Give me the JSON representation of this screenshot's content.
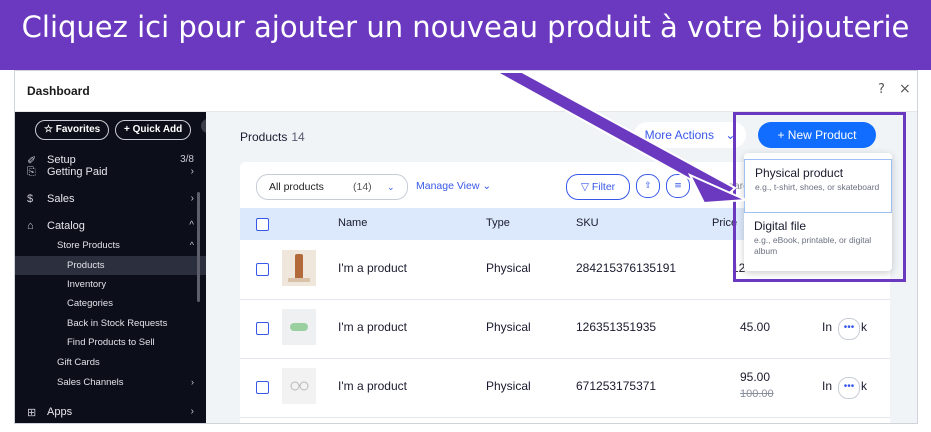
{
  "banner": {
    "text": "Cliquez ici pour ajouter un nouveau produit à votre bijouterie"
  },
  "window": {
    "title": "Dashboard",
    "help": "?",
    "close": "×"
  },
  "sidebar": {
    "favorites": "☆ Favorites",
    "quick_add": "+ Quick Add",
    "collapse": "‹",
    "items": [
      {
        "icon": "✐",
        "label": "Setup",
        "right": "3/8"
      },
      {
        "icon": "⎘",
        "label": "Getting Paid",
        "right": "›"
      },
      {
        "icon": "$",
        "label": "Sales",
        "right": "›"
      },
      {
        "icon": "⌂",
        "label": "Catalog",
        "right": "^"
      }
    ],
    "subitems": [
      {
        "label": "Store Products",
        "right": "^"
      },
      {
        "label": "Products",
        "right": ""
      },
      {
        "label": "Inventory",
        "right": ""
      },
      {
        "label": "Categories",
        "right": ""
      },
      {
        "label": "Back in Stock Requests",
        "right": ""
      },
      {
        "label": "Find Products to Sell",
        "right": ""
      },
      {
        "label": "Gift Cards",
        "right": ""
      },
      {
        "label": "Sales Channels",
        "right": "›"
      }
    ],
    "apps": {
      "icon": "⊞",
      "label": "Apps",
      "right": "›"
    }
  },
  "main": {
    "title": "Products",
    "count": "14",
    "more_actions": "More Actions",
    "more_actions_chev": "⌄",
    "new_product": "+ New Product",
    "toolbar": {
      "select_label": "All products",
      "select_count": "(14)",
      "select_chev": "⌄",
      "manage_view": "Manage View ⌄",
      "filter": "▽ Filter",
      "export_icon": "⇧",
      "columns_icon": "≡",
      "search_placeholder": "earch..."
    },
    "columns": {
      "name": "Name",
      "type": "Type",
      "sku": "SKU",
      "price": "Price"
    },
    "rows": [
      {
        "name": "I'm a product",
        "type": "Physical",
        "sku": "284215376135191",
        "price": "12",
        "old_price": "",
        "inventory": ""
      },
      {
        "name": "I'm a product",
        "type": "Physical",
        "sku": "126351351935",
        "price": "45.00",
        "old_price": "",
        "inventory": "In",
        "inventory_tail": "k"
      },
      {
        "name": "I'm a product",
        "type": "Physical",
        "sku": "671253175371",
        "price": "95.00",
        "old_price": "100.00",
        "inventory": "In",
        "inventory_tail": "k"
      }
    ]
  },
  "dropdown": {
    "items": [
      {
        "title": "Physical product",
        "desc": "e.g., t-shirt, shoes, or skateboard"
      },
      {
        "title": "Digital file",
        "desc": "e.g., eBook, printable, or digital album"
      }
    ]
  },
  "colors": {
    "accent": "#6b39bf",
    "primary": "#116dff",
    "sidebar_bg": "#0c0e19"
  }
}
